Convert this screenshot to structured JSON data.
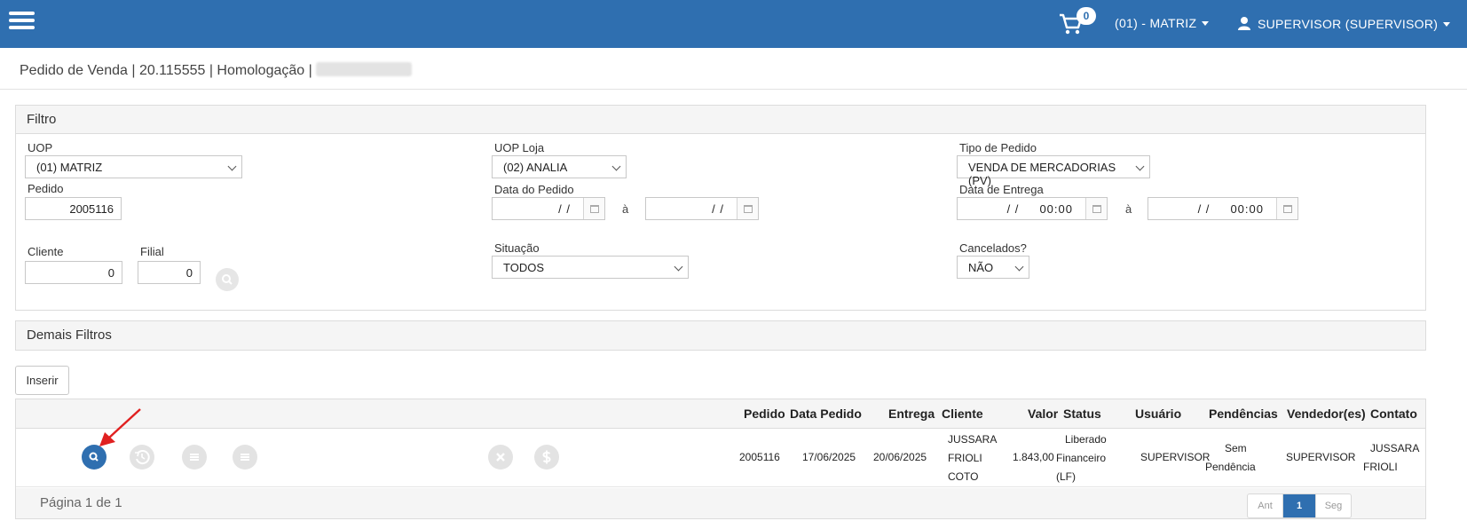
{
  "header": {
    "cart_count": "0",
    "unit_label": "(01) - MATRIZ",
    "user_label": "SUPERVISOR (SUPERVISOR)",
    "brand_color": "#2f6fb0"
  },
  "page": {
    "title": "Pedido de Venda | 20.115555 | Homologação |"
  },
  "filtro": {
    "title": "Filtro",
    "uop": {
      "label": "UOP",
      "value": "(01) MATRIZ"
    },
    "pedido": {
      "label": "Pedido",
      "value": "2005116"
    },
    "cliente": {
      "label": "Cliente",
      "value": "0"
    },
    "filial": {
      "label": "Filial",
      "value": "0"
    },
    "uop_loja": {
      "label": "UOP Loja",
      "value": "(02) ANALIA"
    },
    "data_pedido": {
      "label": "Data do Pedido",
      "from": "/ /",
      "separator": "à",
      "to": "/ /"
    },
    "situacao": {
      "label": "Situação",
      "value": "TODOS"
    },
    "tipo_pedido": {
      "label": "Tipo de Pedido",
      "value": "VENDA DE MERCADORIAS (PV)"
    },
    "data_entrega": {
      "label": "Data de Entrega",
      "from": "/ /     00:00",
      "separator": "à",
      "to": "/ /     00:00"
    },
    "cancelados": {
      "label": "Cancelados?",
      "value": "NÃO"
    }
  },
  "demais_filtros": {
    "title": "Demais Filtros"
  },
  "actions": {
    "inserir_label": "Inserir"
  },
  "table": {
    "columns": [
      "Pedido",
      "Data Pedido",
      "Entrega",
      "Cliente",
      "Valor",
      "Status",
      "Usuário",
      "Pendências",
      "Vendedor(es)",
      "Contato"
    ],
    "rows": [
      {
        "pedido": "2005116",
        "data_pedido": "17/06/2025",
        "entrega": "20/06/2025",
        "cliente_lines": [
          "JUSSARA",
          "FRIOLI",
          "COTO"
        ],
        "valor": "1.843,00",
        "status_lines": [
          "Liberado",
          "Financeiro",
          "(LF)"
        ],
        "usuario": "SUPERVISOR",
        "pendencias_lines": [
          "Sem",
          "Pendência"
        ],
        "vendedor": "SUPERVISOR",
        "contato_lines": [
          "JUSSARA",
          "FRIOLI"
        ],
        "row_icons": [
          "search-icon",
          "history-icon",
          "list-icon",
          "list-icon",
          "cancel-icon",
          "dollar-icon"
        ]
      }
    ],
    "footer": {
      "page_info": "Página 1 de 1",
      "prev_label": "Ant",
      "current_page": "1",
      "next_label": "Seg"
    }
  }
}
